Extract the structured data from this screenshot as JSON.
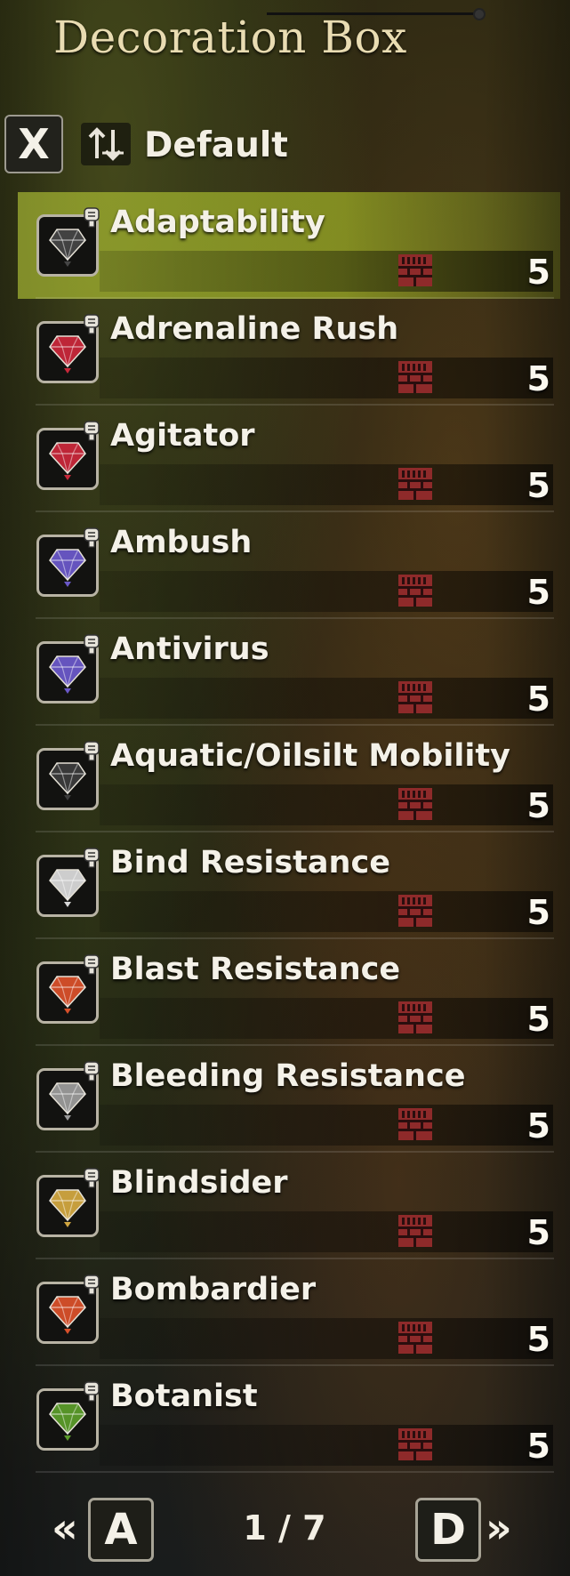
{
  "title": "Decoration Box",
  "sort": {
    "key": "X",
    "label": "Default"
  },
  "colors": {
    "selected": "#bcd23a",
    "slot": "#8e2a2a"
  },
  "decorations": [
    {
      "name": "Adaptability",
      "quantity": "5",
      "gem_color": "#454545",
      "selected": true
    },
    {
      "name": "Adrenaline Rush",
      "quantity": "5",
      "gem_color": "#c8283a",
      "selected": false
    },
    {
      "name": "Agitator",
      "quantity": "5",
      "gem_color": "#c8283a",
      "selected": false
    },
    {
      "name": "Ambush",
      "quantity": "5",
      "gem_color": "#6a58c8",
      "selected": false
    },
    {
      "name": "Antivirus",
      "quantity": "5",
      "gem_color": "#6a58c8",
      "selected": false
    },
    {
      "name": "Aquatic/Oilsilt Mobility",
      "quantity": "5",
      "gem_color": "#3c3c3c",
      "selected": false
    },
    {
      "name": "Bind Resistance",
      "quantity": "5",
      "gem_color": "#d8d8d8",
      "selected": false
    },
    {
      "name": "Blast Resistance",
      "quantity": "5",
      "gem_color": "#d8502a",
      "selected": false
    },
    {
      "name": "Bleeding Resistance",
      "quantity": "5",
      "gem_color": "#9a9a9a",
      "selected": false
    },
    {
      "name": "Blindsider",
      "quantity": "5",
      "gem_color": "#d0a640",
      "selected": false
    },
    {
      "name": "Bombardier",
      "quantity": "5",
      "gem_color": "#d8502a",
      "selected": false
    },
    {
      "name": "Botanist",
      "quantity": "5",
      "gem_color": "#5a9a2a",
      "selected": false
    }
  ],
  "pager": {
    "prev_key": "A",
    "next_key": "D",
    "page": "1 / 7"
  }
}
